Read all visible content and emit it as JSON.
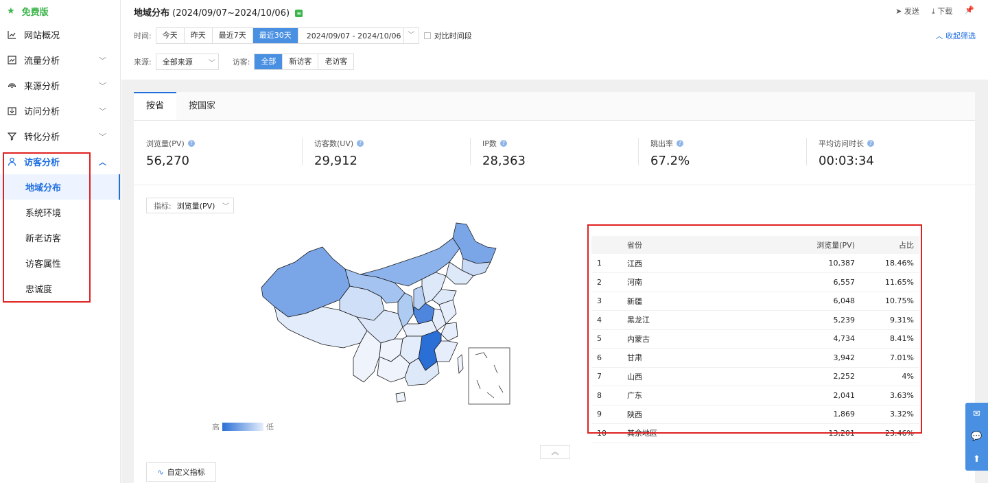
{
  "sidebar": {
    "brand": "免费版",
    "items": [
      {
        "label": "网站概况",
        "icon": "line-chart-icon",
        "has_arrow": false
      },
      {
        "label": "流量分析",
        "icon": "image-chart-icon",
        "has_arrow": true
      },
      {
        "label": "来源分析",
        "icon": "signal-icon",
        "has_arrow": true
      },
      {
        "label": "访问分析",
        "icon": "download-box-icon",
        "has_arrow": true
      },
      {
        "label": "转化分析",
        "icon": "funnel-icon",
        "has_arrow": true
      },
      {
        "label": "访客分析",
        "icon": "user-icon",
        "has_arrow": true,
        "active": true
      }
    ],
    "sub_items": [
      {
        "label": "地域分布",
        "active": true
      },
      {
        "label": "系统环境"
      },
      {
        "label": "新老访客"
      },
      {
        "label": "访客属性"
      },
      {
        "label": "忠诚度"
      }
    ]
  },
  "header": {
    "title": "地域分布",
    "date_range_title": "(2024/09/07~2024/10/06)",
    "badge": "≡",
    "actions": {
      "send": "发送",
      "download": "下载"
    },
    "time_label": "时间:",
    "time_options": [
      "今天",
      "昨天",
      "最近7天",
      "最近30天"
    ],
    "time_selected": "最近30天",
    "date_range": "2024/09/07 - 2024/10/06",
    "compare_label": "对比时间段",
    "collapse_label": "收起筛选",
    "source_label": "来源:",
    "source_value": "全部来源",
    "visitor_label": "访客:",
    "visitor_options": [
      "全部",
      "新访客",
      "老访客"
    ],
    "visitor_selected": "全部"
  },
  "tabs": [
    "按省",
    "按国家"
  ],
  "stats": [
    {
      "label": "浏览量(PV)",
      "value": "56,270"
    },
    {
      "label": "访客数(UV)",
      "value": "29,912"
    },
    {
      "label": "IP数",
      "value": "28,363"
    },
    {
      "label": "跳出率",
      "value": "67.2%"
    },
    {
      "label": "平均访问时长",
      "value": "00:03:34"
    }
  ],
  "metric_select": {
    "label": "指标:",
    "value": "浏览量(PV)"
  },
  "legend": {
    "high": "高",
    "low": "低"
  },
  "table": {
    "headers": [
      "",
      "省份",
      "浏览量(PV)",
      "占比"
    ],
    "rows": [
      [
        "1",
        "江西",
        "10,387",
        "18.46%"
      ],
      [
        "2",
        "河南",
        "6,557",
        "11.65%"
      ],
      [
        "3",
        "新疆",
        "6,048",
        "10.75%"
      ],
      [
        "4",
        "黑龙江",
        "5,239",
        "9.31%"
      ],
      [
        "5",
        "内蒙古",
        "4,734",
        "8.41%"
      ],
      [
        "6",
        "甘肃",
        "3,942",
        "7.01%"
      ],
      [
        "7",
        "山西",
        "2,252",
        "4%"
      ],
      [
        "8",
        "广东",
        "2,041",
        "3.63%"
      ],
      [
        "9",
        "陕西",
        "1,869",
        "3.32%"
      ],
      [
        "10",
        "其余地区",
        "13,201",
        "23.46%"
      ]
    ]
  },
  "custom_metric_label": "自定义指标",
  "colors": {
    "accent": "#1f6fe0",
    "highlight_box": "#e02020",
    "brand_green": "#3bb54a"
  }
}
